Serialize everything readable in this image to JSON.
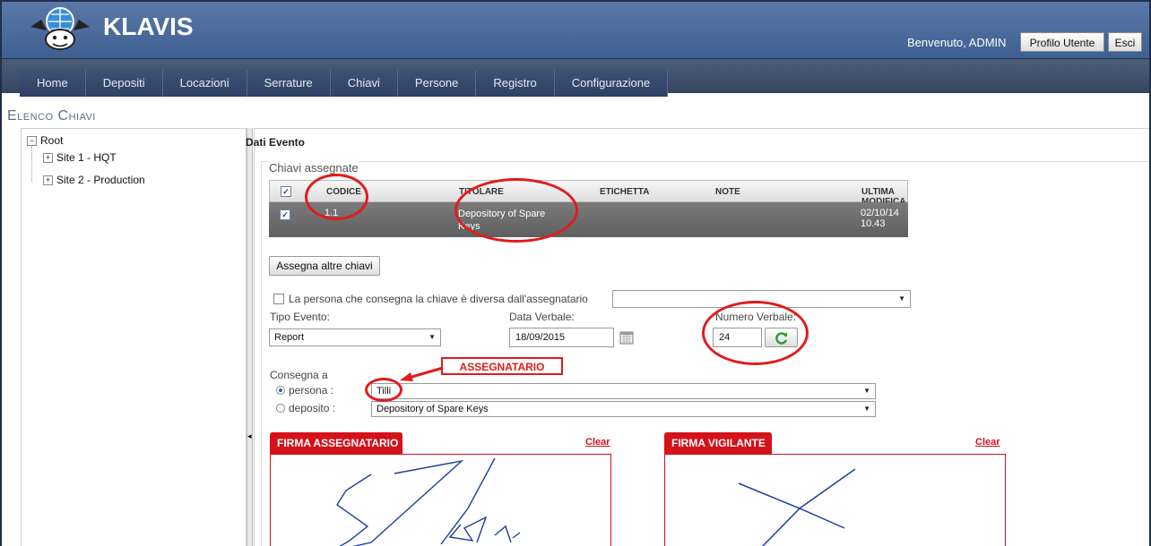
{
  "header": {
    "app_title": "KLAVIS",
    "welcome": "Benvenuto, ADMIN",
    "profile_button": "Profilo Utente",
    "exit_button": "Esci"
  },
  "nav": {
    "items": [
      "Home",
      "Depositi",
      "Locazioni",
      "Serrature",
      "Chiavi",
      "Persone",
      "Registro",
      "Configurazione"
    ]
  },
  "page": {
    "title": "Elenco Chiavi"
  },
  "tree": {
    "root": "Root",
    "children": [
      "Site 1 - HQT",
      "Site 2 - Production"
    ]
  },
  "section": {
    "title": "Dati Evento",
    "legend": "Chiavi assegnate"
  },
  "table": {
    "headers": {
      "code": "CODICE",
      "holder": "TITOLARE",
      "label": "ETICHETTA",
      "notes": "NOTE",
      "modified": "ULTIMA MODIFICA"
    },
    "rows": [
      {
        "code": "1.1",
        "holder_line1": "Depository of Spare",
        "holder_line2": "Keys",
        "label": "",
        "notes": "",
        "modified": "02/10/14 10.43"
      }
    ]
  },
  "form": {
    "assign_more": "Assegna altre chiavi",
    "different_person_label": "La persona che consegna la chiave è diversa dall'assegnatario",
    "event_type_label": "Tipo Evento:",
    "event_type_value": "Report",
    "report_date_label": "Data Verbale:",
    "report_date_value": "18/09/2015",
    "report_number_label": "Numero Verbale:",
    "report_number_value": "24",
    "deliver_to_label": "Consegna a",
    "person_label": "persona :",
    "person_value": "Tilli",
    "deposit_label": "deposito :",
    "deposit_value": "Depository of Spare Keys"
  },
  "signatures": {
    "assignee_title": "FIRMA ASSEGNATARIO",
    "guard_title": "FIRMA VIGILANTE",
    "clear": "Clear"
  },
  "annotation": {
    "label": "ASSEGNATARIO"
  },
  "colors": {
    "header": "#4a6b9c",
    "nav": "#3e5276",
    "accent_red": "#d5111a",
    "annotation_red": "#e21b1b"
  }
}
